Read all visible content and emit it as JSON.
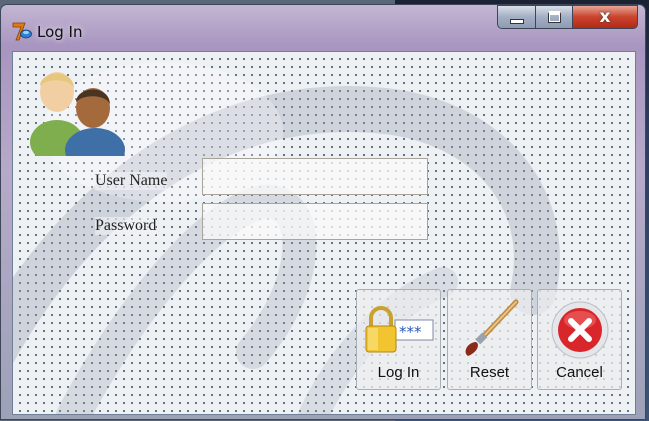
{
  "window": {
    "title": "Log In",
    "close_glyph": "x",
    "icons": {
      "app": "app-logo-icon",
      "minimize": "minimize-icon",
      "maximize": "maximize-icon",
      "close": "close-icon"
    }
  },
  "form": {
    "username_label": "User Name",
    "password_label": "Password",
    "username_value": "",
    "password_value": "",
    "header_icon": "users-icon"
  },
  "actions": {
    "login_label": "Log In",
    "reset_label": "Reset",
    "cancel_label": "Cancel",
    "login_icon": "lock-password-icon",
    "reset_icon": "paintbrush-icon",
    "cancel_icon": "cancel-x-icon"
  },
  "colors": {
    "close_button": "#c9432d",
    "cancel_icon": "#d8262a"
  }
}
